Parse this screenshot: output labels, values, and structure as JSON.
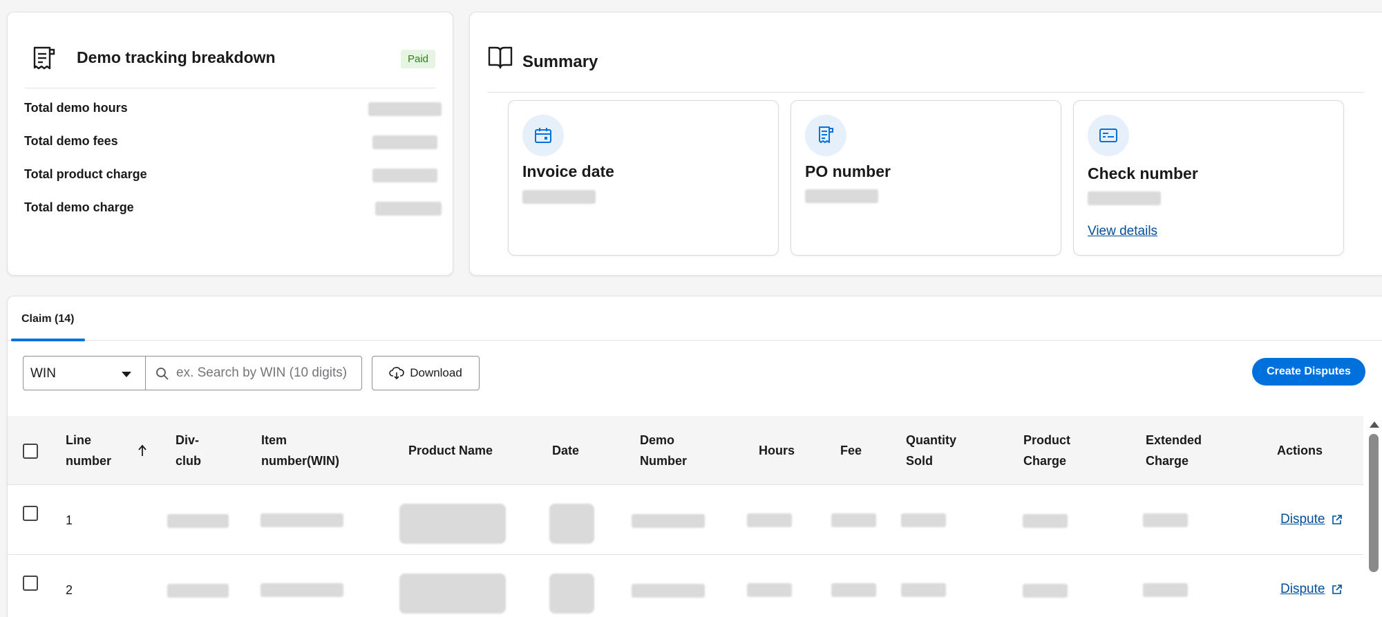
{
  "demo_tracking": {
    "title": "Demo tracking breakdown",
    "badge": "Paid",
    "stats": [
      {
        "label": "Total demo hours"
      },
      {
        "label": "Total demo fees"
      },
      {
        "label": "Total product charge"
      },
      {
        "label": "Total demo charge"
      }
    ]
  },
  "summary": {
    "title": "Summary",
    "cards": [
      {
        "title": "Invoice date",
        "icon": "calendar-icon"
      },
      {
        "title": "PO number",
        "icon": "receipt-icon"
      },
      {
        "title": "Check number",
        "icon": "check-icon",
        "link": "View details"
      }
    ]
  },
  "claim": {
    "tab_label": "Claim (14)",
    "filter_select": "WIN",
    "search_placeholder": "ex. Search by WIN (10 digits)",
    "download_label": "Download",
    "create_label": "Create Disputes",
    "columns": {
      "line_1": "Line",
      "line_2": "number",
      "div_1": "Div-",
      "div_2": "club",
      "item_1": "Item",
      "item_2": "number(WIN)",
      "product_name": "Product Name",
      "date": "Date",
      "demo_1": "Demo",
      "demo_2": "Number",
      "hours": "Hours",
      "fee": "Fee",
      "qty_1": "Quantity",
      "qty_2": "Sold",
      "pc_1": "Product",
      "pc_2": "Charge",
      "ec_1": "Extended",
      "ec_2": "Charge",
      "actions": "Actions"
    },
    "rows": [
      {
        "line": "1",
        "action": "Dispute"
      },
      {
        "line": "2",
        "action": "Dispute"
      }
    ]
  },
  "colors": {
    "accent": "#0071dc",
    "link": "#004f9a",
    "badge_bg": "#e7f4e4",
    "badge_text": "#2a8703"
  }
}
